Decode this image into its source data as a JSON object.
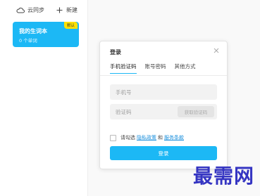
{
  "toolbar": {
    "sync_label": "云同步",
    "new_label": "新建"
  },
  "notebooks": [
    {
      "title": "我的生词本",
      "count": "0 个单词",
      "badge": "默认"
    }
  ],
  "login_dialog": {
    "title": "登录",
    "tabs": [
      {
        "label": "手机验证码",
        "active": true
      },
      {
        "label": "账号密码",
        "active": false
      },
      {
        "label": "其他方式",
        "active": false
      }
    ],
    "phone_placeholder": "手机号",
    "code_placeholder": "验证码",
    "get_code_label": "获取验证码",
    "agree_prefix": "请勾选",
    "privacy_link": "隐私政策",
    "and_text": "和",
    "terms_link": "服务条款",
    "submit_label": "登录"
  },
  "watermark": "最需网",
  "colors": {
    "accent": "#1cb8f5",
    "badge": "#ffe100",
    "link": "#1a8fdc"
  }
}
